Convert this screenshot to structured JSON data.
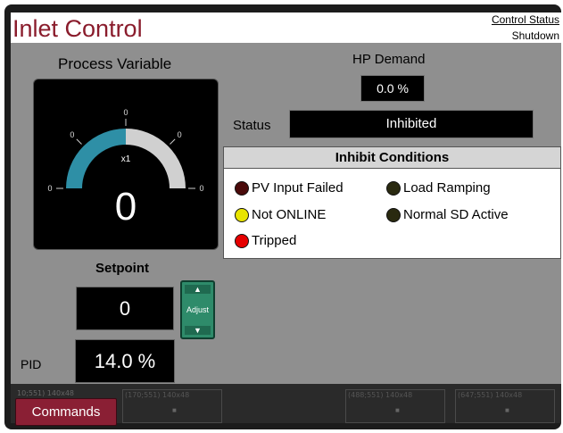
{
  "header": {
    "title": "Inlet Control",
    "control_status_link": "Control Status",
    "control_status_value": "Shutdown"
  },
  "process_variable": {
    "title": "Process Variable",
    "value": "0",
    "gauge": {
      "multiplier": "x1",
      "tick_labels": [
        "0",
        "0",
        "0",
        "0",
        "0"
      ],
      "fill_fraction": 0.5,
      "arc_color": "#2e8fa6"
    }
  },
  "hp_demand": {
    "label": "HP Demand",
    "value": "0.0 %"
  },
  "status": {
    "label": "Status",
    "value": "Inhibited"
  },
  "inhibit_conditions": {
    "title": "Inhibit Conditions",
    "items": [
      {
        "label": "PV Input Failed",
        "state": "off",
        "color": "#4a0a0a"
      },
      {
        "label": "Load Ramping",
        "state": "off",
        "color": "#2a2a10"
      },
      {
        "label": "Not ONLINE",
        "state": "on",
        "color": "#e8e400"
      },
      {
        "label": "Normal SD Active",
        "state": "off",
        "color": "#2a2a10"
      },
      {
        "label": "Tripped",
        "state": "on",
        "color": "#e60000"
      }
    ]
  },
  "setpoint": {
    "label": "Setpoint",
    "value": "0",
    "adjust_label": "Adjust"
  },
  "pid": {
    "label": "PID",
    "value": "14.0 %"
  },
  "footer": {
    "commands_label": "Commands",
    "slot_labels": [
      "10;551) 140x48",
      "(170;551) 140x48",
      "(488;551) 140x48",
      "(647;551) 140x48"
    ],
    "slot_dot": "■"
  },
  "colors": {
    "title_red": "#8a1c2c",
    "panel_gray": "#8f8f8f",
    "adjust_green": "#2e8b6a",
    "commands_red": "#8a1f34"
  }
}
